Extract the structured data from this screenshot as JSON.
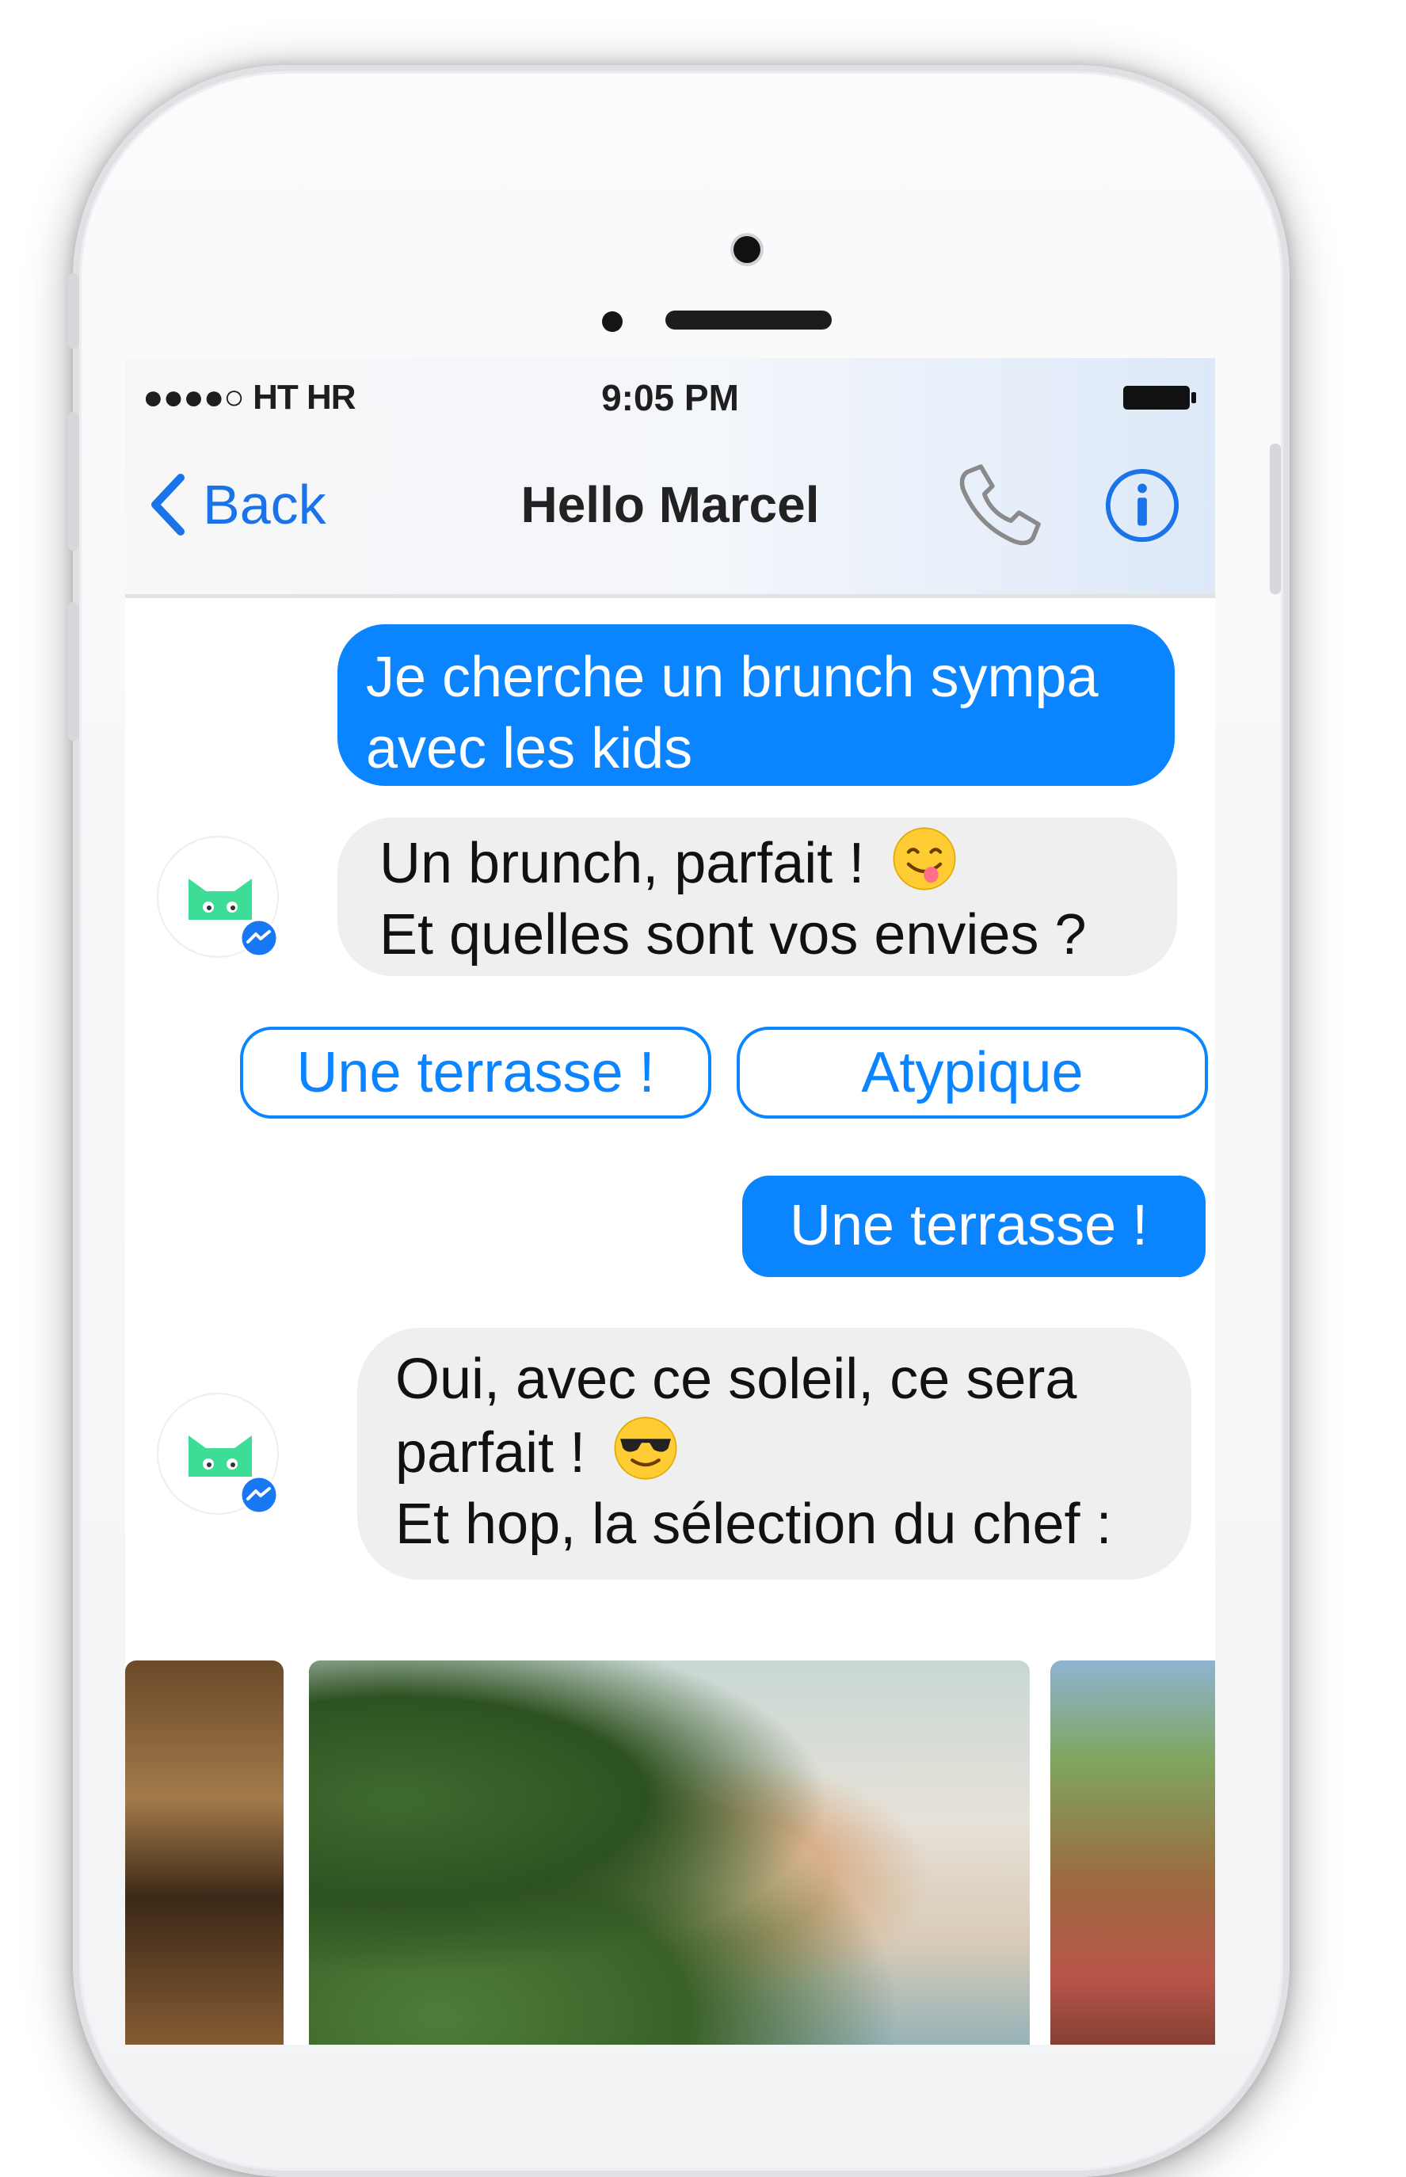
{
  "status_bar": {
    "carrier": "●●●●○ HT HR",
    "time": "9:05 PM"
  },
  "nav": {
    "back_label": "Back",
    "title": "Hello Marcel"
  },
  "messages": [
    {
      "sender": "user",
      "lines": [
        "Je cherche un brunch sympa",
        "avec les kids"
      ]
    },
    {
      "sender": "bot",
      "lines": [
        "Un brunch, parfait !",
        "Et quelles sont vos envies ?"
      ],
      "emoji": "yum-emoji"
    },
    {
      "sender": "user",
      "lines": [
        "Une terrasse !"
      ]
    },
    {
      "sender": "bot",
      "lines": [
        "Oui, avec ce soleil, ce sera",
        "parfait !",
        "Et hop, la sélection du chef :"
      ],
      "emoji": "sunglasses-emoji"
    }
  ],
  "quick_replies": [
    "Une terrasse !",
    "Atypique"
  ],
  "colors": {
    "accent": "#0a84ff",
    "incoming_bubble": "#efefef",
    "brand_green": "#3ddc97"
  },
  "carousel": [
    "restaurant-interior-photo",
    "terrace-plants-photo",
    "garden-photo"
  ]
}
